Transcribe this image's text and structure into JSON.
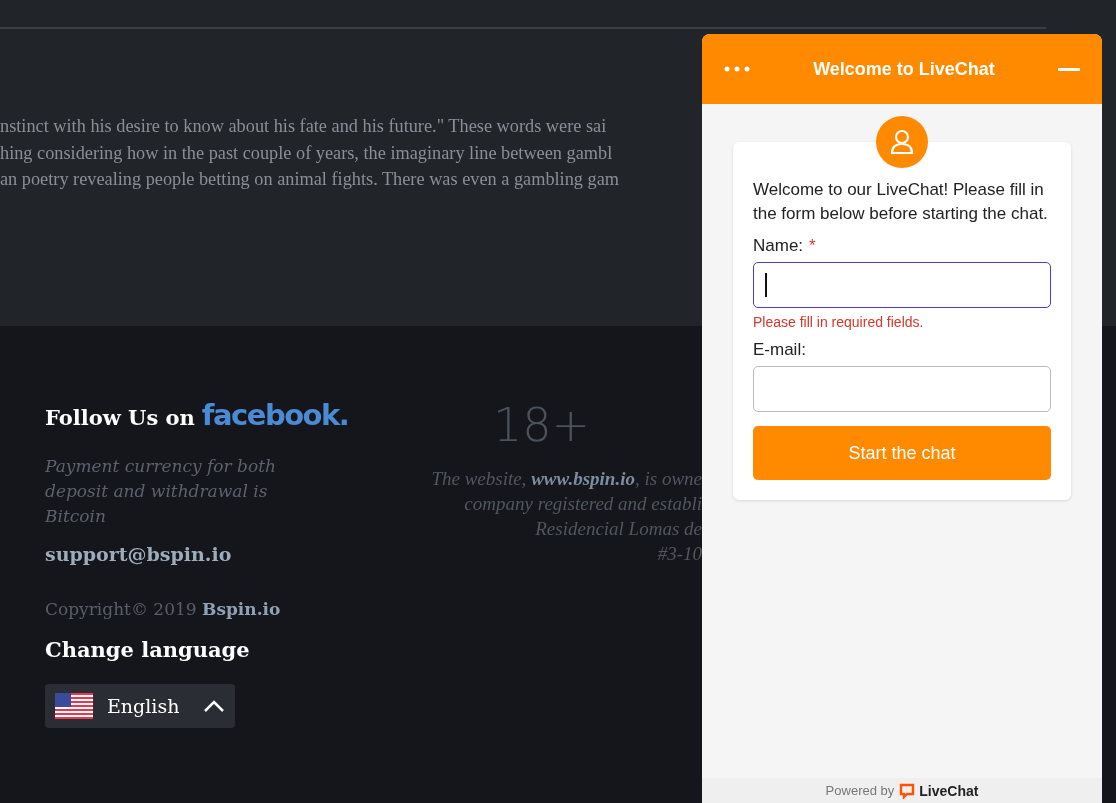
{
  "article": {
    "lines": [
      "nstinct with his desire to know about his fate and his future.\" These words were sai",
      "hing considering how in the past couple of years, the imaginary line between gambl",
      "an poetry revealing people betting on animal fights. There was even a gambling gam"
    ]
  },
  "footer": {
    "follow_label": "Follow Us on",
    "facebook_logo": "facebook.",
    "payment_note": "Payment currency for both deposit and withdrawal is Bitcoin",
    "email": "support@bspin.io",
    "copyright": "Copyright© 2019 **Bspin.io**",
    "language_heading": "Change language",
    "language": {
      "label": "English",
      "expanded": true
    },
    "age_badge": "18+",
    "legal_lines": [
      "The website, **www.bspin.io**, is owne",
      "company registered and establi",
      "Residencial Lomas de",
      "#3-10"
    ]
  },
  "chat": {
    "title": "Welcome to LiveChat",
    "intro": "Welcome to our LiveChat! Please fill in the form below before starting the chat.",
    "required_mark": "*",
    "fields": [
      {
        "label": "Name:",
        "required": true,
        "focused": true,
        "error": "Please fill in required fields."
      },
      {
        "label": "E-mail:",
        "required": false,
        "focused": false
      }
    ],
    "submit": "Start the chat",
    "powered_by": "Powered by",
    "brand": "LiveChat"
  }
}
